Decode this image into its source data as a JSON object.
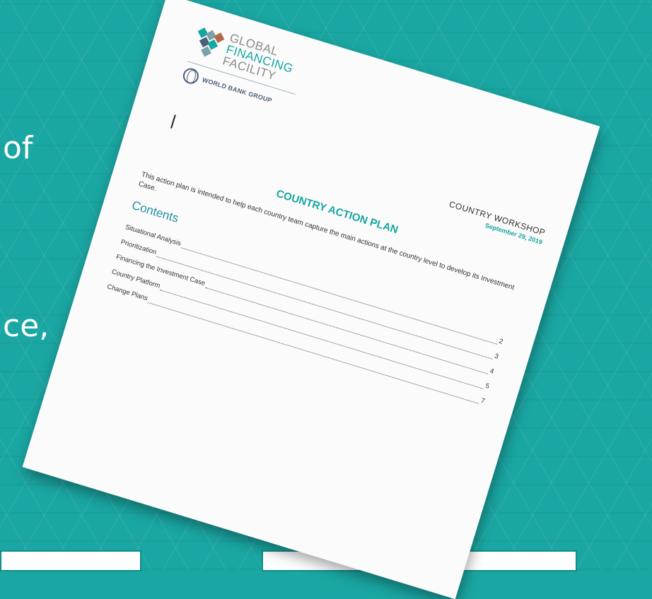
{
  "background": {
    "partial_text": [
      "of",
      "ce,"
    ],
    "color": "#1aa6a2"
  },
  "document": {
    "logo": {
      "line1": "GLOBAL",
      "line2": "FINANCING",
      "line3": "FACILITY",
      "group": "WORLD BANK GROUP"
    },
    "workshop": {
      "title": "COUNTRY WORKSHOP",
      "date": "September 29, 2019"
    },
    "title": "COUNTRY ACTION PLAN",
    "intro": "This action plan is intended to help each country team capture the main actions at the country level to develop its Investment Case.",
    "contents_heading": "Contents",
    "toc": [
      {
        "label": "Situational Analysis",
        "page": "2"
      },
      {
        "label": "Prioritization",
        "page": "3"
      },
      {
        "label": "Financing the Investment Case",
        "page": "4"
      },
      {
        "label": "Country Platform",
        "page": "5"
      },
      {
        "label": "Change Plans",
        "page": "7"
      }
    ]
  }
}
